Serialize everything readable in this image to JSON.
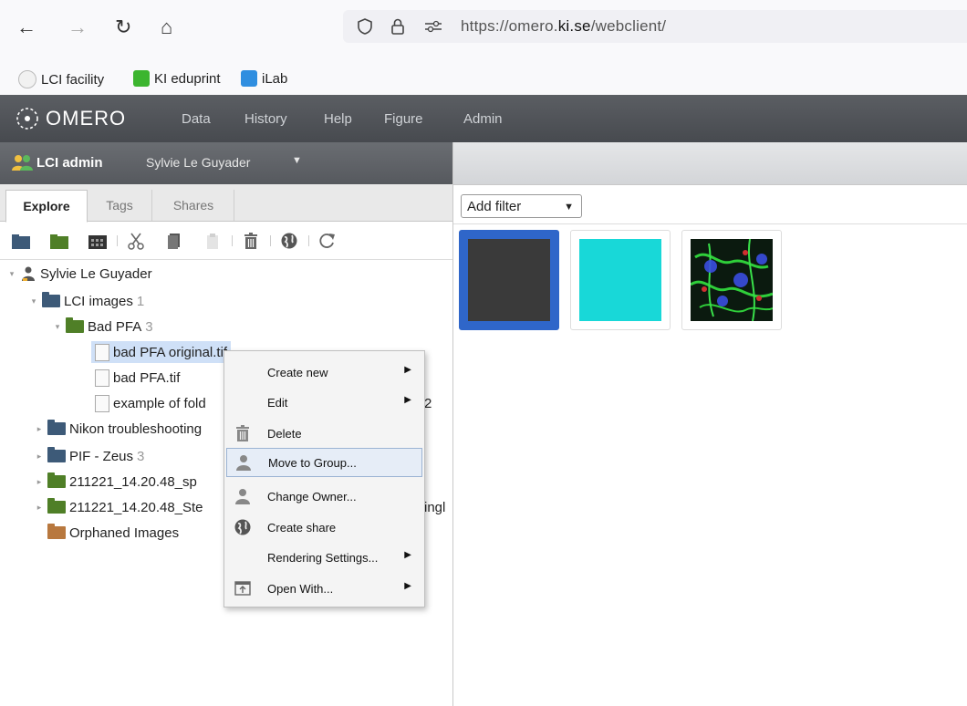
{
  "browser": {
    "url_prefix": "https://omero.",
    "url_domain": "ki.se",
    "url_path": "/webclient/",
    "bookmarks": [
      "LCI facility",
      "KI eduprint",
      "iLab"
    ]
  },
  "app": {
    "logo": "OMERO",
    "nav": [
      "Data",
      "History",
      "Help",
      "Figure",
      "Admin"
    ]
  },
  "user_bar": {
    "group": "LCI admin",
    "user": "Sylvie Le Guyader"
  },
  "tabs": [
    "Explore",
    "Tags",
    "Shares"
  ],
  "tree": {
    "root": "Sylvie Le Guyader",
    "lci_images": {
      "label": "LCI images",
      "count": "1"
    },
    "bad_pfa": {
      "label": "Bad PFA",
      "count": "3"
    },
    "images": [
      "bad PFA original.tif",
      "bad PFA.tif",
      "example of fold"
    ],
    "example_suffix": "2",
    "nikon": "Nikon troubleshooting",
    "pif": {
      "label": "PIF - Zeus",
      "count": "3"
    },
    "ds1": "211221_14.20.48_sp",
    "ds2": "211221_14.20.48_Ste",
    "ds2_suffix": "ingl",
    "orphaned": "Orphaned Images"
  },
  "context_menu": {
    "items": [
      {
        "label": "Create new",
        "submenu": true,
        "icon": ""
      },
      {
        "label": "Edit",
        "submenu": true,
        "icon": ""
      },
      {
        "label": "Delete",
        "submenu": false,
        "icon": "trash-icon"
      },
      {
        "label": "Move to Group...",
        "submenu": false,
        "icon": "user-icon"
      },
      {
        "label": "Change Owner...",
        "submenu": false,
        "icon": "user-icon"
      },
      {
        "label": "Create share",
        "submenu": false,
        "icon": "globe-icon"
      },
      {
        "label": "Rendering Settings...",
        "submenu": true,
        "icon": ""
      },
      {
        "label": "Open With...",
        "submenu": true,
        "icon": "open-with-icon"
      }
    ],
    "hovered": "Move to Group..."
  },
  "filter": {
    "label": "Add filter"
  },
  "thumbnails": [
    {
      "name": "thumb-gray",
      "color": "#3a3a3a",
      "selected": true
    },
    {
      "name": "thumb-cyan",
      "color": "#18d8d8",
      "selected": false
    },
    {
      "name": "thumb-fluor",
      "color": "#0b2a14",
      "selected": false
    }
  ],
  "colors": {
    "accent": "#2f66c9",
    "header": "#4b4e53",
    "hover": "#e6edf7"
  }
}
